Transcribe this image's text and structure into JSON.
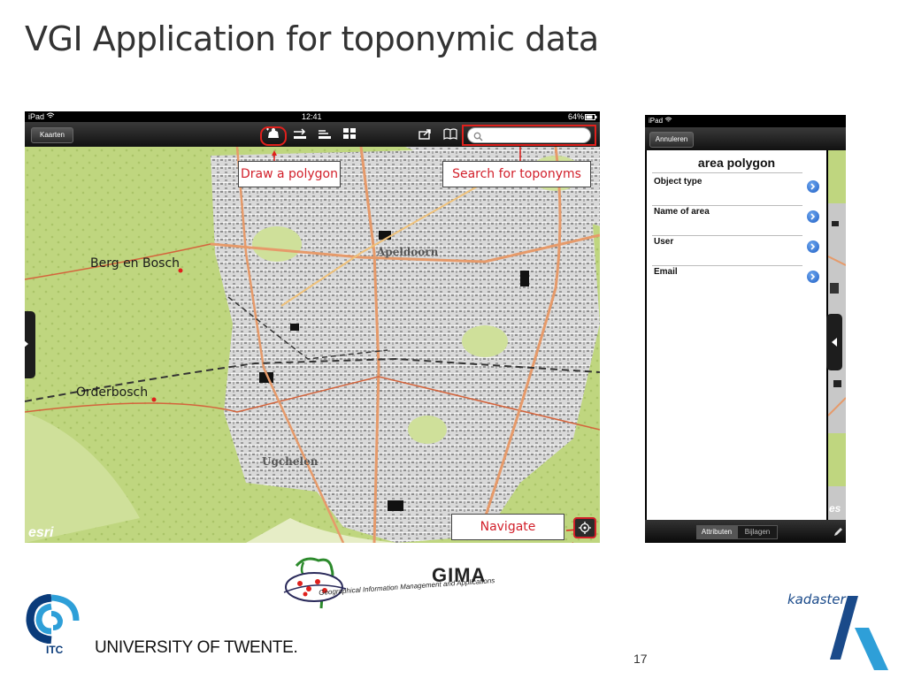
{
  "slide": {
    "title": "VGI Application for toponymic data",
    "page_number": "17"
  },
  "left_screen": {
    "status": {
      "device": "iPad",
      "time": "12:41",
      "battery": "64%"
    },
    "nav": {
      "back_button": "Kaarten",
      "search_placeholder": ""
    },
    "callouts": {
      "draw": "Draw a polygon",
      "search": "Search for toponyms",
      "navigate": "Navigate"
    },
    "places": {
      "berg": "Berg en Bosch",
      "orderbosch": "Orderbosch",
      "apeldoorn": "Apeldoorn",
      "ugchelen": "Ugchelen"
    },
    "esri": "esri"
  },
  "right_screen": {
    "status": {
      "device": "iPad"
    },
    "nav": {
      "cancel_button": "Annuleren"
    },
    "panel_title": "area polygon",
    "fields": [
      "Object type",
      "Name of area",
      "User",
      "Email"
    ],
    "tabs": [
      "Attributen",
      "Bijlagen"
    ],
    "esri": "es"
  },
  "logos": {
    "gima": "GIMA",
    "gima_sub": "Geographical Information Management and Applications",
    "itc": "ITC",
    "utwente": "UNIVERSITY OF TWENTE.",
    "kadaster": "kadaster"
  },
  "colors": {
    "callout_text": "#d21f2a",
    "map_green": "#c6dc8c",
    "urban": "#cfcfcf",
    "accent_red": "#e0201c"
  }
}
